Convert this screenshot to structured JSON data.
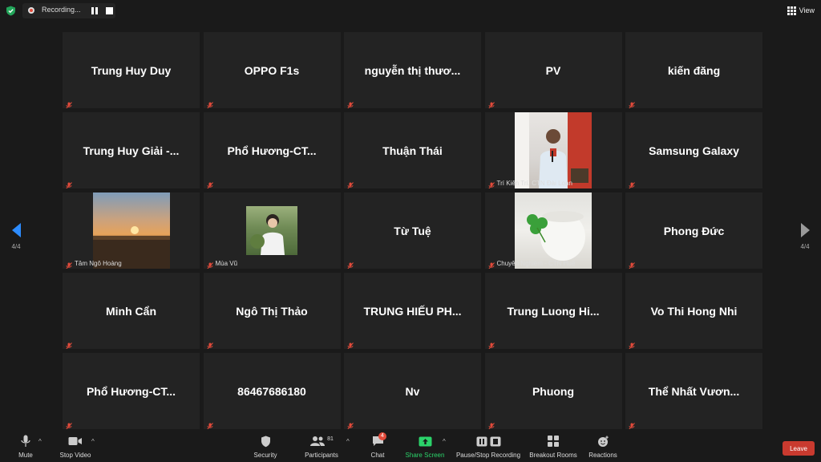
{
  "recording": {
    "label": "Recording..."
  },
  "view_button": {
    "label": "View"
  },
  "pagination": {
    "left_page": "4/4",
    "right_page": "4/4"
  },
  "participants": [
    {
      "name": "Trung Huy Duy",
      "muted": true
    },
    {
      "name": "OPPO F1s",
      "muted": true
    },
    {
      "name": "nguyễn thị thươ...",
      "muted": true
    },
    {
      "name": "PV",
      "muted": true
    },
    {
      "name": "kiến đăng",
      "muted": true
    },
    {
      "name": "Trung Huy Giải -...",
      "muted": true
    },
    {
      "name": "Phổ Hương-CT...",
      "muted": true
    },
    {
      "name": "Thuận Thái",
      "muted": true
    },
    {
      "name": "",
      "label": "Trí Kiên Trí. CTN Đài Loan",
      "video": "speaker-photo",
      "muted": true
    },
    {
      "name": "Samsung Galaxy",
      "muted": true
    },
    {
      "name": "",
      "label": "Tâm Ngô Hoàng",
      "video": "sunset-photo",
      "muted": true
    },
    {
      "name": "",
      "label": "Mùa Vũ",
      "video": "girl-photo",
      "muted": true
    },
    {
      "name": "Từ Tuệ",
      "muted": true
    },
    {
      "name": "",
      "label": "Chuyên Nghiệm - CTN Huế",
      "video": "clover-photo",
      "muted": true
    },
    {
      "name": "Phong Đức",
      "muted": true
    },
    {
      "name": "Minh Cẩn",
      "muted": true
    },
    {
      "name": "Ngô Thị Thảo",
      "muted": true
    },
    {
      "name": "TRUNG HIẾU PH...",
      "muted": true
    },
    {
      "name": "Trung Luong Hi...",
      "muted": true
    },
    {
      "name": "Vo Thi Hong Nhi",
      "muted": true
    },
    {
      "name": "Phổ Hương-CT...",
      "muted": true
    },
    {
      "name": "86467686180",
      "muted": true
    },
    {
      "name": "Nv",
      "muted": true
    },
    {
      "name": "Phuong",
      "muted": true
    },
    {
      "name": "Thể Nhất Vươn...",
      "muted": true
    }
  ],
  "toolbar": {
    "mute": "Mute",
    "stop_video": "Stop Video",
    "security": "Security",
    "participants": "Participants",
    "participants_count": "81",
    "chat": "Chat",
    "chat_badge": "4",
    "share_screen": "Share Screen",
    "pause_stop_recording": "Pause/Stop Recording",
    "breakout_rooms": "Breakout Rooms",
    "reactions": "Reactions",
    "leave": "Leave"
  },
  "colors": {
    "accent": "#2d8cff",
    "share_green": "#2bd36a",
    "leave_red": "#c93a2f",
    "mute_red": "#e24b3b",
    "tile_bg": "#232323"
  }
}
